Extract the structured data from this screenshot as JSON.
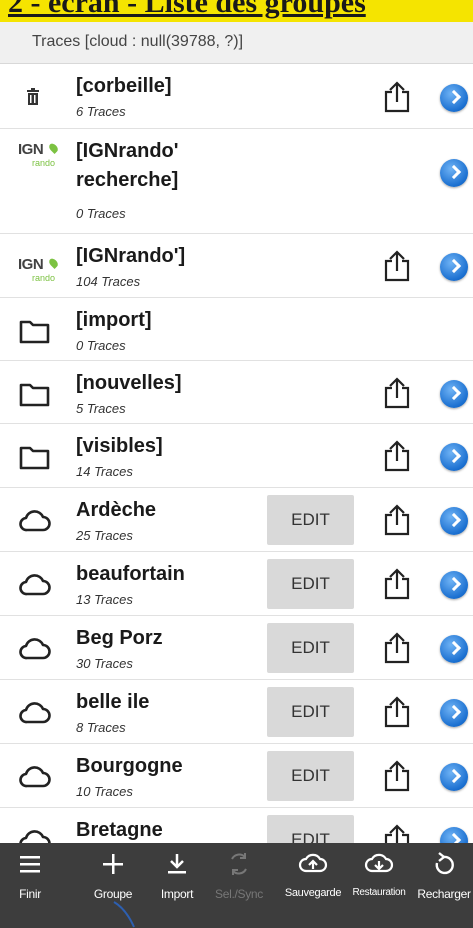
{
  "banner": {
    "text": "2 - écran - Liste des groupes"
  },
  "header": {
    "title": "Traces [cloud : null(39788, ?)]"
  },
  "rows": [
    {
      "name": "[corbeille]",
      "count": "6 Traces",
      "icon": "trash-icon",
      "edit": false,
      "share": true,
      "nav": true
    },
    {
      "name": "[IGNrando' recherche]",
      "count": "0 Traces",
      "icon": "ign-logo",
      "edit": false,
      "share": false,
      "nav": true
    },
    {
      "name": "[IGNrando']",
      "count": "104 Traces",
      "icon": "ign-logo",
      "edit": false,
      "share": true,
      "nav": true
    },
    {
      "name": "[import]",
      "count": "0 Traces",
      "icon": "folder-icon",
      "edit": false,
      "share": false,
      "nav": false
    },
    {
      "name": "[nouvelles]",
      "count": "5 Traces",
      "icon": "folder-icon",
      "edit": false,
      "share": true,
      "nav": true
    },
    {
      "name": "[visibles]",
      "count": "14 Traces",
      "icon": "folder-icon",
      "edit": false,
      "share": true,
      "nav": true
    },
    {
      "name": "Ardèche",
      "count": "25 Traces",
      "icon": "cloud-icon",
      "edit": true,
      "share": true,
      "nav": true
    },
    {
      "name": "beaufortain",
      "count": "13 Traces",
      "icon": "cloud-icon",
      "edit": true,
      "share": true,
      "nav": true
    },
    {
      "name": "Beg Porz",
      "count": "30 Traces",
      "icon": "cloud-icon",
      "edit": true,
      "share": true,
      "nav": true
    },
    {
      "name": "belle ile",
      "count": "8 Traces",
      "icon": "cloud-icon",
      "edit": true,
      "share": true,
      "nav": true
    },
    {
      "name": "Bourgogne",
      "count": "10 Traces",
      "icon": "cloud-icon",
      "edit": true,
      "share": true,
      "nav": true
    },
    {
      "name": "Bretagne",
      "count": "",
      "icon": "cloud-icon",
      "edit": true,
      "share": true,
      "nav": true
    }
  ],
  "ign": {
    "logo_text": "IGN",
    "logo_sub": "rando"
  },
  "edit_label": "EDIT",
  "toolbar": {
    "finir": "Finir",
    "groupe": "Groupe",
    "import": "Import",
    "selsync": "Sel./Sync",
    "sauvegarde": "Sauvegarde",
    "restauration": "Restauration",
    "recharger": "Recharger"
  },
  "colors": {
    "banner": "#f5e400",
    "toolbar": "#3d3d3d",
    "edit_button": "#d9d9d9",
    "nav_blue": "#1a6fd0",
    "ign_green": "#7cc242"
  }
}
